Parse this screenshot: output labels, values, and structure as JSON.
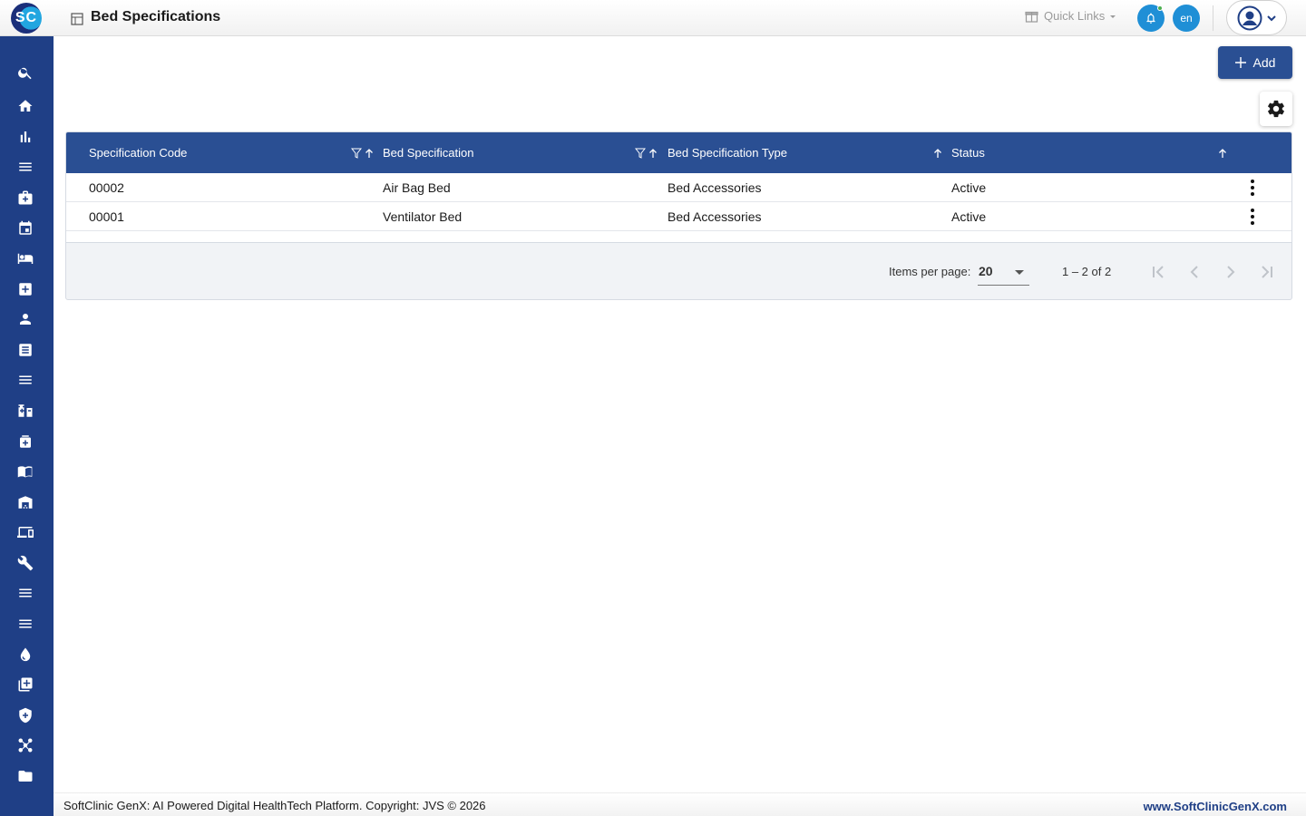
{
  "app": {
    "logo_text": "SC",
    "page_title": "Bed Specifications"
  },
  "header": {
    "quick_links": "Quick Links",
    "language": "en"
  },
  "sidebar": {
    "items": [
      {
        "icon": "search-icon"
      },
      {
        "icon": "home-icon"
      },
      {
        "icon": "bar-chart-icon"
      },
      {
        "icon": "menu-icon"
      },
      {
        "icon": "medical-bag-icon"
      },
      {
        "icon": "calendar-icon"
      },
      {
        "icon": "bed-icon"
      },
      {
        "icon": "medical-plus-icon"
      },
      {
        "icon": "person-icon"
      },
      {
        "icon": "document-icon"
      },
      {
        "icon": "menu-icon"
      },
      {
        "icon": "pharmacy-icon"
      },
      {
        "icon": "medicine-icon"
      },
      {
        "icon": "book-icon"
      },
      {
        "icon": "warehouse-icon"
      },
      {
        "icon": "devices-icon"
      },
      {
        "icon": "wrench-icon"
      },
      {
        "icon": "menu-icon"
      },
      {
        "icon": "menu-icon"
      },
      {
        "icon": "blood-drop-icon"
      },
      {
        "icon": "add-library-icon"
      },
      {
        "icon": "shield-icon"
      },
      {
        "icon": "network-icon"
      },
      {
        "icon": "folder-icon"
      }
    ]
  },
  "toolbar": {
    "add_label": "Add"
  },
  "table": {
    "columns": [
      "Specification Code",
      "Bed Specification",
      "Bed Specification Type",
      "Status"
    ],
    "rows": [
      {
        "code": "00002",
        "spec": "Air Bag Bed",
        "type": "Bed Accessories",
        "status": "Active"
      },
      {
        "code": "00001",
        "spec": "Ventilator Bed",
        "type": "Bed Accessories",
        "status": "Active"
      }
    ]
  },
  "paginator": {
    "items_per_page_label": "Items per page:",
    "items_per_page": "20",
    "range": "1 – 2 of 2"
  },
  "footer": {
    "left": "SoftClinic GenX: AI Powered Digital HealthTech Platform. Copyright: JVS © 2026",
    "right": "www.SoftClinicGenX.com"
  },
  "colors": {
    "primary": "#2a4f93",
    "sidebar": "#1f3f86",
    "accent": "#1f8fd6"
  }
}
